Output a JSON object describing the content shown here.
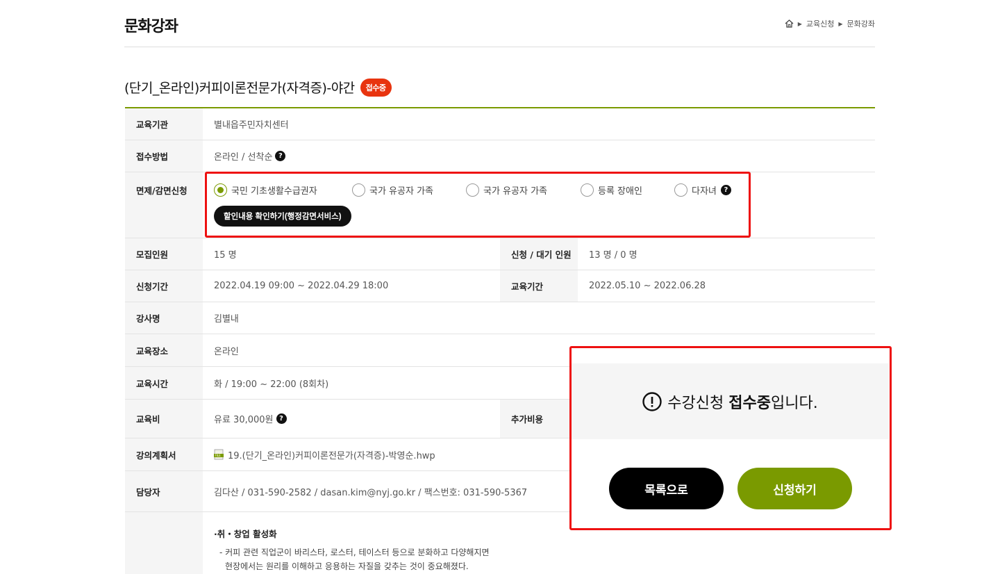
{
  "header": {
    "page_title": "문화강좌",
    "breadcrumb": [
      "교육신청",
      "문화강좌"
    ]
  },
  "course": {
    "title": "(단기_온라인)커피이론전문가(자격증)-야간",
    "status": "접수중"
  },
  "table": {
    "org_label": "교육기관",
    "org_value": "별내읍주민자치센터",
    "method_label": "접수방법",
    "method_value": "온라인 / 선착순",
    "discount_label": "면제/감면신청",
    "discount_options": [
      "국민 기초생활수급권자",
      "국가 유공자 가족",
      "국가 유공자 가족",
      "등록 장애인",
      "다자녀"
    ],
    "discount_selected": 0,
    "discount_button": "할인내용 확인하기(행정감면서비스)",
    "capacity_label": "모집인원",
    "capacity_value": "15 명",
    "applied_label": "신청 / 대기 인원",
    "applied_value": "13 명 / 0 명",
    "apply_period_label": "신청기간",
    "apply_period_value": "2022.04.19 09:00 ~ 2022.04.29 18:00",
    "edu_period_label": "교육기간",
    "edu_period_value": "2022.05.10 ~ 2022.06.28",
    "instructor_label": "강사명",
    "instructor_value": "김별내",
    "place_label": "교육장소",
    "place_value": "온라인",
    "time_label": "교육시간",
    "time_value": "화 / 19:00 ~ 22:00 (8회차)",
    "fee_label": "교육비",
    "fee_value": "유료 30,000원",
    "extra_label": "추가비용",
    "plan_label": "강의계획서",
    "plan_file": "19.(단기_온라인)커피이론전문가(자격증)-박영순.hwp",
    "contact_label": "담당자",
    "contact_value": "김다산 / 031-590-2582 / dasan.kim@nyj.go.kr / 팩스번호: 031-590-5367",
    "desc_head": "·취・창업 활성화",
    "desc_line1": "- 커피 관련 직업군이 바리스타, 로스터, 테이스터 등으로 분화하고 다양해지면",
    "desc_line2": "현장에서는 원리를 이해하고 응용하는 자질을 갖추는 것이 중요해졌다."
  },
  "modal": {
    "msg_prefix": "수강신청 ",
    "msg_bold": "접수중",
    "msg_suffix": "입니다.",
    "list_button": "목록으로",
    "apply_button": "신청하기"
  }
}
